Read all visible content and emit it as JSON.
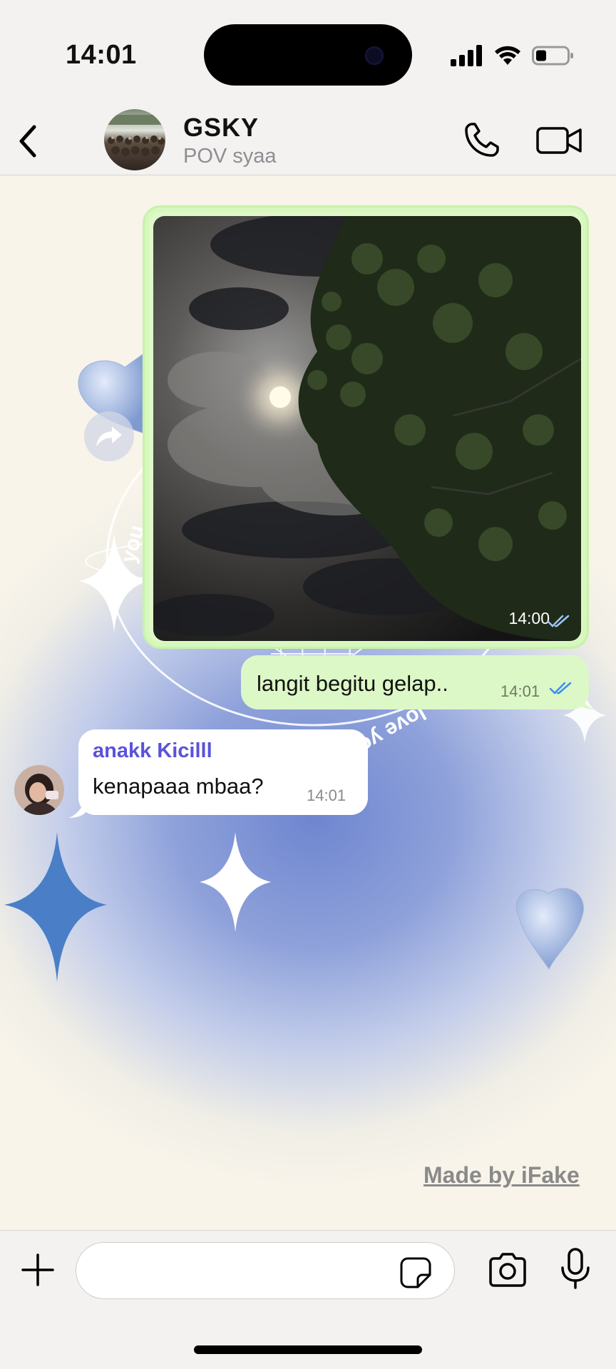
{
  "status_bar": {
    "time": "14:01"
  },
  "header": {
    "group_name": "GSKY",
    "subtitle": "POV syaa"
  },
  "messages": [
    {
      "type": "image",
      "direction": "outgoing",
      "time": "14:00",
      "status": "read"
    },
    {
      "type": "text",
      "direction": "outgoing",
      "text": "langit begitu gelap..",
      "time": "14:01",
      "status": "read"
    },
    {
      "type": "text",
      "direction": "incoming",
      "sender": "anakk Kicilll",
      "text": "kenapaaa mbaa?",
      "time": "14:01"
    }
  ],
  "wallpaper": {
    "ring_text_1": "love yourself",
    "ring_text_2": "you"
  },
  "watermark": "Made by iFake",
  "input": {
    "placeholder": ""
  },
  "colors": {
    "outgoing_bubble": "#dcf8c6",
    "incoming_bubble": "#ffffff",
    "sender_name": "#5a53d9",
    "read_ticks": "#3d8ef0"
  },
  "icons": [
    "back-chevron-icon",
    "phone-icon",
    "video-camera-icon",
    "forward-icon",
    "plus-icon",
    "sticker-icon",
    "camera-icon",
    "microphone-icon",
    "signal-icon",
    "wifi-icon",
    "battery-icon"
  ]
}
